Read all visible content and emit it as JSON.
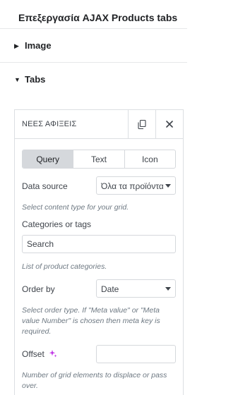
{
  "header": {
    "title": "Επεξεργασία AJAX Products tabs"
  },
  "sections": {
    "image": {
      "label": "Image"
    },
    "tabs": {
      "label": "Tabs"
    }
  },
  "panel": {
    "title": "ΝΕΕΣ ΑΦΙΞΕΙΣ",
    "tab_buttons": {
      "query": "Query",
      "text": "Text",
      "icon": "Icon",
      "active": "Query"
    },
    "data_source": {
      "label": "Data source",
      "value": "Όλα τα προϊόντα",
      "description": "Select content type for your grid."
    },
    "categories": {
      "label": "Categories or tags",
      "placeholder": "Search",
      "description": "List of product categories."
    },
    "order_by": {
      "label": "Order by",
      "value": "Date",
      "description": "Select order type. If \"Meta value\" or \"Meta value Number\" is chosen then meta key is required."
    },
    "offset": {
      "label": "Offset",
      "value": "",
      "description": "Number of grid elements to displace or pass over."
    }
  },
  "colors": {
    "accent_icon": "#c036e6",
    "tab_active_bg": "#d5d8dc",
    "border": "#d5d8dc",
    "description": "#6d7882"
  }
}
